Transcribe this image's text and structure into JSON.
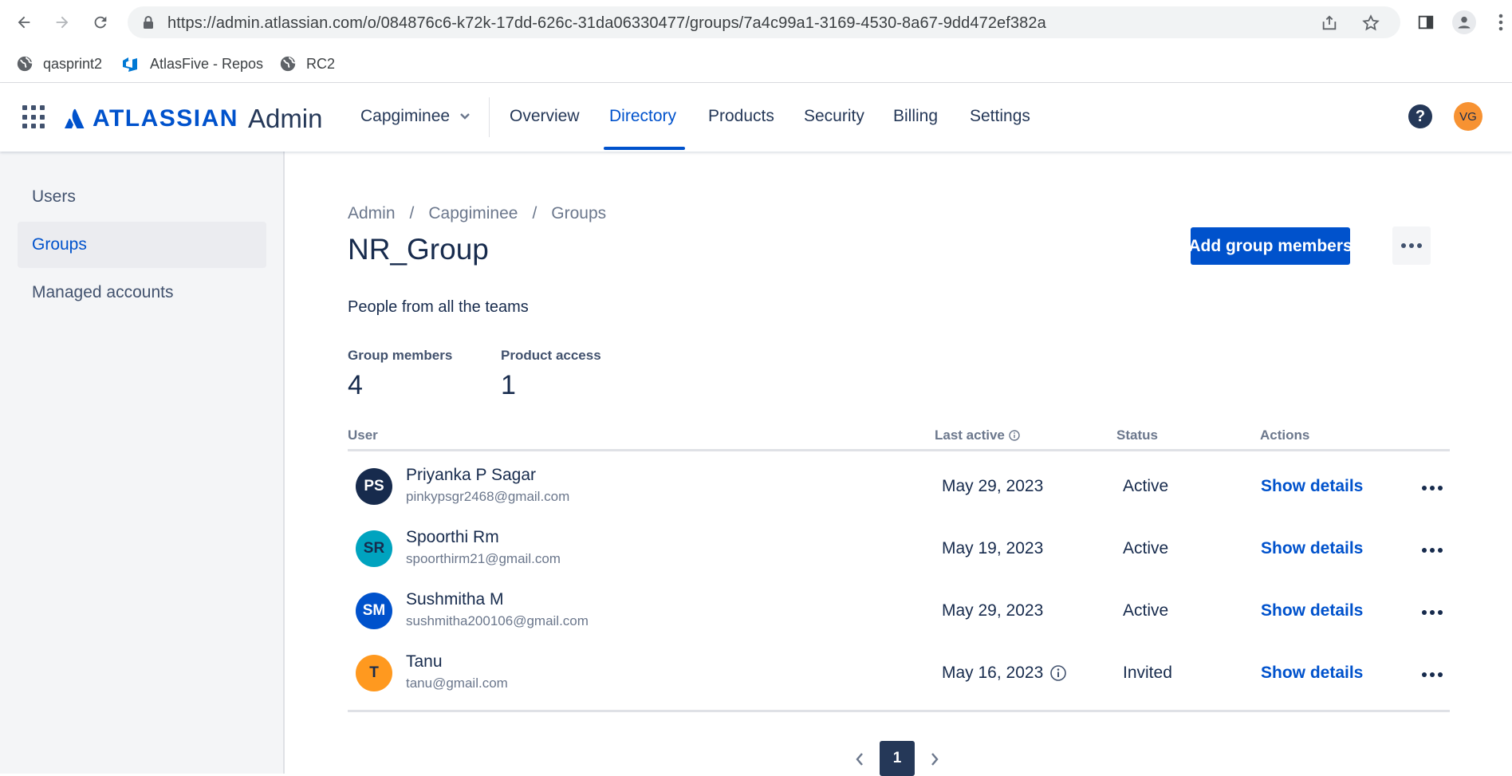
{
  "browser": {
    "url": "https://admin.atlassian.com/o/084876c6-k72k-17dd-626c-31da06330477/groups/7a4c99a1-3169-4530-8a67-9dd472ef382a",
    "bookmarks": [
      {
        "label": "qasprint2",
        "icon": "globe-icon"
      },
      {
        "label": "AtlasFive - Repos",
        "icon": "azure-devops-icon"
      },
      {
        "label": "RC2",
        "icon": "globe-icon"
      }
    ]
  },
  "header": {
    "logo_text": "ATLASSIAN",
    "logo_suffix": "Admin",
    "org_name": "Capgiminee",
    "nav": [
      "Overview",
      "Directory",
      "Products",
      "Security",
      "Billing",
      "Settings"
    ],
    "active_nav": "Directory",
    "help_label": "?",
    "user_initials": "VG",
    "brand_color": "#0052cc"
  },
  "sidebar": {
    "items": [
      {
        "label": "Users"
      },
      {
        "label": "Groups"
      },
      {
        "label": "Managed accounts"
      }
    ],
    "active": "Groups"
  },
  "main": {
    "breadcrumbs": [
      "Admin",
      "Capgiminee",
      "Groups"
    ],
    "breadcrumb_separator": "/",
    "title": "NR_Group",
    "add_button": "Add group members",
    "description": "People from all the teams",
    "stats": [
      {
        "label": "Group members",
        "value": "4"
      },
      {
        "label": "Product access",
        "value": "1"
      }
    ],
    "table": {
      "headers": {
        "user": "User",
        "last_active": "Last active",
        "status": "Status",
        "actions": "Actions"
      },
      "rows": [
        {
          "initials": "PS",
          "name": "Priyanka P Sagar",
          "email": "pinkypsgr2468@gmail.com",
          "last_active": "May 29, 2023",
          "status": "Active",
          "action": "Show details",
          "avatar_color": "#172b4d",
          "avatar_text": "#ffffff",
          "info_icon": false
        },
        {
          "initials": "SR",
          "name": "Spoorthi Rm",
          "email": "spoorthirm21@gmail.com",
          "last_active": "May 19, 2023",
          "status": "Active",
          "action": "Show details",
          "avatar_color": "#00a3bf",
          "avatar_text": "#172b4d",
          "info_icon": false
        },
        {
          "initials": "SM",
          "name": "Sushmitha M",
          "email": "sushmitha200106@gmail.com",
          "last_active": "May 29, 2023",
          "status": "Active",
          "action": "Show details",
          "avatar_color": "#0052cc",
          "avatar_text": "#ffffff",
          "info_icon": false
        },
        {
          "initials": "T",
          "name": "Tanu",
          "email": "tanu@gmail.com",
          "last_active": "May 16, 2023",
          "status": "Invited",
          "action": "Show details",
          "avatar_color": "#ff991f",
          "avatar_text": "#172b4d",
          "info_icon": true
        }
      ]
    },
    "pagination": {
      "current_page": "1"
    }
  }
}
